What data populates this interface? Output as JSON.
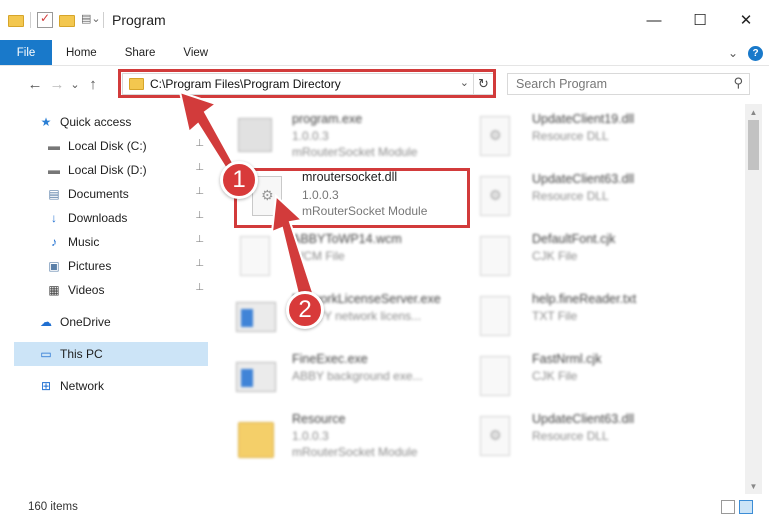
{
  "window": {
    "title": "Program",
    "minimize": "—",
    "maximize": "☐",
    "close": "✕"
  },
  "ribbon": {
    "tabs": [
      "File",
      "Home",
      "Share",
      "View"
    ],
    "help": "?",
    "collapse": "⌄"
  },
  "nav": {
    "back": "←",
    "forward": "→",
    "recent": "⌄",
    "up": "↑",
    "address": "C:\\Program Files\\Program Directory",
    "dropdown": "⌄",
    "refresh": "↻",
    "search_placeholder": "Search Program",
    "search_icon": "⚲"
  },
  "sidebar": {
    "items": [
      {
        "label": "Quick access",
        "icon": "star-icon",
        "glyph": "★",
        "color": "#2b7fd4"
      },
      {
        "label": "Local Disk (C:)",
        "icon": "drive-icon",
        "glyph": "▬",
        "color": "#777777",
        "pinned": true
      },
      {
        "label": "Local Disk (D:)",
        "icon": "drive-icon",
        "glyph": "▬",
        "color": "#777777",
        "pinned": true
      },
      {
        "label": "Documents",
        "icon": "documents-icon",
        "glyph": "▤",
        "color": "#5a7fa8",
        "pinned": true
      },
      {
        "label": "Downloads",
        "icon": "download-icon",
        "glyph": "↓",
        "color": "#1f6fd1",
        "pinned": true
      },
      {
        "label": "Music",
        "icon": "music-icon",
        "glyph": "♪",
        "color": "#1f6fd1",
        "pinned": true
      },
      {
        "label": "Pictures",
        "icon": "pictures-icon",
        "glyph": "▣",
        "color": "#5a7fa8",
        "pinned": true
      },
      {
        "label": "Videos",
        "icon": "videos-icon",
        "glyph": "▦",
        "color": "#444444",
        "pinned": true
      },
      {
        "label": "OneDrive",
        "icon": "cloud-icon",
        "glyph": "☁",
        "color": "#1f6fd1"
      },
      {
        "label": "This PC",
        "icon": "computer-icon",
        "glyph": "▭",
        "color": "#1f6fd1",
        "selected": true
      },
      {
        "label": "Network",
        "icon": "network-icon",
        "glyph": "⊞",
        "color": "#1f6fd1"
      }
    ],
    "pin_glyph": "📌"
  },
  "files": {
    "left": [
      {
        "name": "program.exe",
        "line1": "1.0.0.3",
        "line2": "mRouterSocket Module",
        "kind": "exe",
        "blurred": true
      },
      {
        "name": "mroutersocket.dll",
        "line1": "1.0.0.3",
        "line2": "mRouterSocket Module",
        "kind": "dll",
        "blurred": false
      },
      {
        "name": "ABBYToWP14.wcm",
        "line1": "WCM File",
        "line2": "",
        "kind": "doc",
        "blurred": true
      },
      {
        "name": "NetworkLicenseServer.exe",
        "line1": "ABBYY network licens...",
        "line2": "",
        "kind": "app",
        "blurred": true
      },
      {
        "name": "FineExec.exe",
        "line1": "ABBY background exe...",
        "line2": "",
        "kind": "app",
        "blurred": true
      },
      {
        "name": "Resource",
        "line1": "1.0.0.3",
        "line2": "mRouterSocket Module",
        "kind": "folder",
        "blurred": true
      }
    ],
    "right": [
      {
        "name": "UpdateClient19.dll",
        "line1": "Resource DLL",
        "kind": "dll"
      },
      {
        "name": "UpdateClient63.dll",
        "line1": "Resource DLL",
        "kind": "dll"
      },
      {
        "name": "DefaultFont.cjk",
        "line1": "CJK File",
        "kind": "doc"
      },
      {
        "name": "help.fineReader.txt",
        "line1": "TXT File",
        "kind": "doc"
      },
      {
        "name": "FastNrml.cjk",
        "line1": "CJK File",
        "kind": "doc"
      },
      {
        "name": "UpdateClient63.dll",
        "line1": "Resource DLL",
        "kind": "dll"
      }
    ]
  },
  "status": {
    "count": "160 items"
  },
  "annotations": {
    "step1": "1",
    "step2": "2",
    "color": "#d23b3b"
  }
}
